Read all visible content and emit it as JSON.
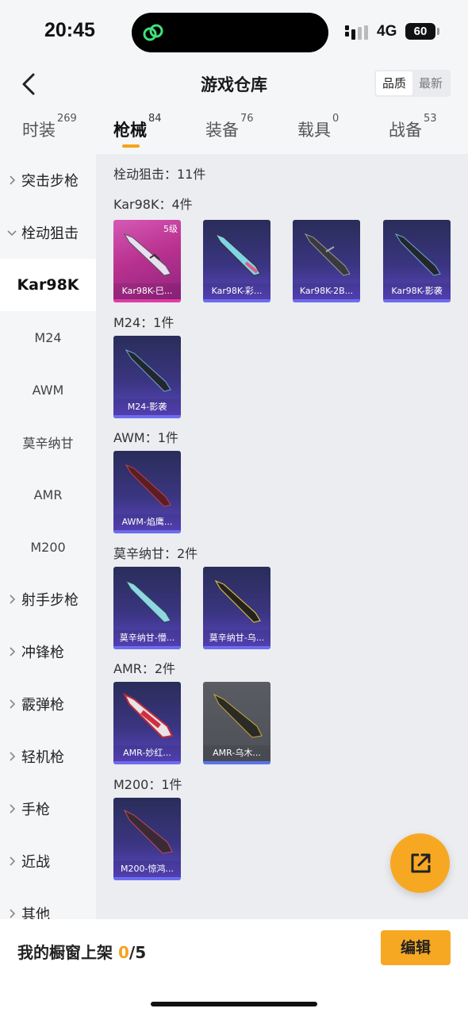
{
  "status_bar": {
    "time": "20:45",
    "network": "4G",
    "battery": "60"
  },
  "header": {
    "title": "游戏仓库",
    "sort_options": [
      "品质",
      "最新"
    ]
  },
  "tabs": [
    {
      "label": "时装",
      "count": "269"
    },
    {
      "label": "枪械",
      "count": "84"
    },
    {
      "label": "装备",
      "count": "76"
    },
    {
      "label": "载具",
      "count": "0"
    },
    {
      "label": "战备",
      "count": "53"
    }
  ],
  "sidebar": {
    "items": [
      {
        "label": "突击步枪"
      },
      {
        "label": "栓动狙击"
      },
      {
        "label": "Kar98K"
      },
      {
        "label": "M24"
      },
      {
        "label": "AWM"
      },
      {
        "label": "莫辛纳甘"
      },
      {
        "label": "AMR"
      },
      {
        "label": "M200"
      },
      {
        "label": "射手步枪"
      },
      {
        "label": "冲锋枪"
      },
      {
        "label": "霰弹枪"
      },
      {
        "label": "轻机枪"
      },
      {
        "label": "手枪"
      },
      {
        "label": "近战"
      },
      {
        "label": "其他"
      }
    ]
  },
  "content": {
    "category_summary": "栓动狙击：11件",
    "groups": [
      {
        "label": "Kar98K：4件",
        "items": [
          {
            "name": "Kar98K-巳...",
            "level": "5级"
          },
          {
            "name": "Kar98K-彩..."
          },
          {
            "name": "Kar98K-2B..."
          },
          {
            "name": "Kar98K-影袭"
          }
        ]
      },
      {
        "label": "M24：1件",
        "items": [
          {
            "name": "M24-影袭"
          }
        ]
      },
      {
        "label": "AWM：1件",
        "items": [
          {
            "name": "AWM-焰鹰..."
          }
        ]
      },
      {
        "label": "莫辛纳甘：2件",
        "items": [
          {
            "name": "莫辛纳甘-懵..."
          },
          {
            "name": "莫辛纳甘-乌..."
          }
        ]
      },
      {
        "label": "AMR：2件",
        "items": [
          {
            "name": "AMR-妙红..."
          },
          {
            "name": "AMR-乌木..."
          }
        ]
      },
      {
        "label": "M200：1件",
        "items": [
          {
            "name": "M200-惊鸿..."
          }
        ]
      }
    ]
  },
  "bottom": {
    "shelf_label": "我的橱窗上架 ",
    "shelf_current": "0",
    "shelf_total": "/5",
    "edit_label": "编辑"
  },
  "colors": {
    "accent": "#f4a41d",
    "card_purple": "#3a3580",
    "card_pink": "#b9328f"
  }
}
